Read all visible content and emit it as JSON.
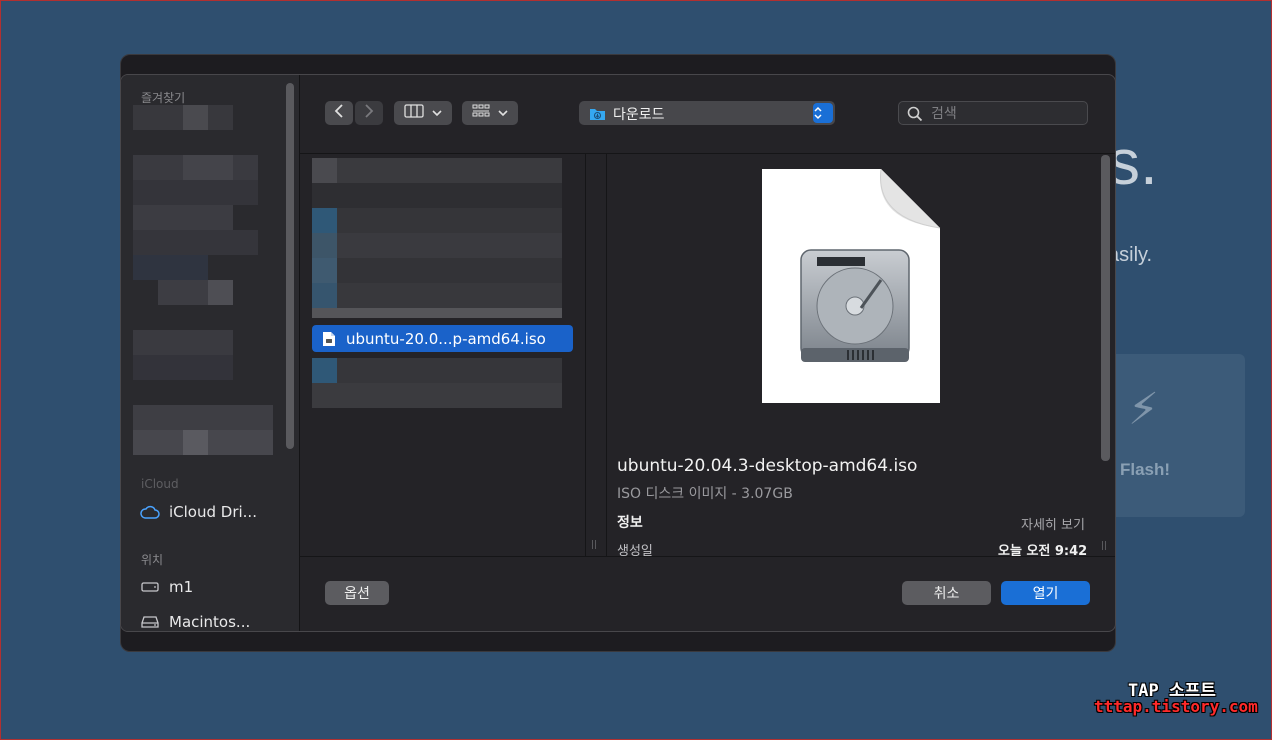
{
  "background_app": {
    "heading_fragment": "s.",
    "subtitle_fragment": "asily.",
    "flash_label": "Flash!"
  },
  "dialog": {
    "sidebar": {
      "favorites_heading": "즐겨찾기",
      "icloud_heading": "iCloud",
      "icloud_drive": "iCloud Dri...",
      "locations_heading": "위치",
      "location_1": "m1",
      "location_2": "Macintos..."
    },
    "toolbar": {
      "location": "다운로드",
      "search_placeholder": "검색"
    },
    "file_list": {
      "selected_file": "ubuntu-20.0...p-amd64.iso"
    },
    "preview": {
      "filename": "ubuntu-20.04.3-desktop-amd64.iso",
      "kind_size": "ISO 디스크 이미지 - 3.07GB",
      "info_label": "정보",
      "show_more": "자세히 보기",
      "created_label": "생성일",
      "created_value": "오늘 오전 9:42"
    },
    "buttons": {
      "options": "옵션",
      "cancel": "취소",
      "open": "열기"
    }
  },
  "watermark": {
    "line1": "TAP 소프트",
    "line2": "tttap.tistory.com"
  },
  "colors": {
    "accent": "#1a6fd6",
    "selection": "#1a62c9",
    "desktop": "#2f4f6f"
  }
}
